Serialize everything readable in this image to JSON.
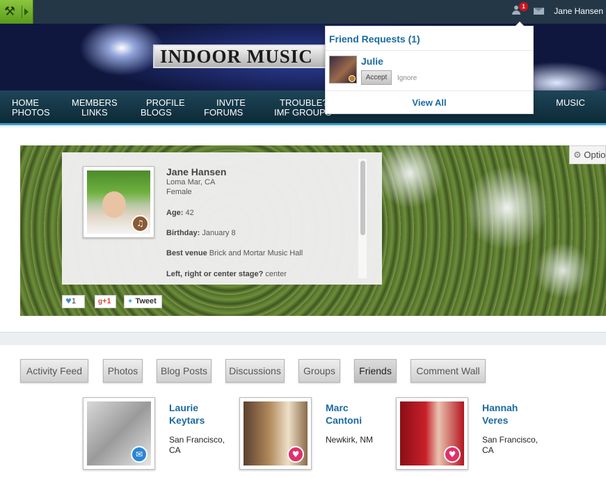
{
  "topbar": {
    "notification_count": "1",
    "username": "Jane Hansen",
    "icons": [
      "apps-tool-icon",
      "friend-requests-icon",
      "mail-icon"
    ]
  },
  "banner": {
    "logo_text": "INDOOR MUSIC"
  },
  "nav": {
    "items": [
      {
        "line1": "HOME",
        "line2": "PHOTOS"
      },
      {
        "line1": "MEMBERS",
        "line2": "LINKS"
      },
      {
        "line1": "PROFILE",
        "line2": "BLOGS"
      },
      {
        "line1": "INVITE",
        "line2": "FORUMS"
      },
      {
        "line1": "TROUBLE?",
        "line2": "IMF GROUPS"
      },
      {
        "line1": "MUSIC",
        "line2": ""
      }
    ]
  },
  "friend_requests": {
    "title": "Friend Requests (1)",
    "requests": [
      {
        "name": "Julie",
        "accept_label": "Accept",
        "ignore_label": "Ignore"
      }
    ],
    "view_all_label": "View All"
  },
  "profile": {
    "name": "Jane Hansen",
    "location": "Loma Mar, CA",
    "gender": "Female",
    "fields": [
      {
        "label": "Age:",
        "value": "42"
      },
      {
        "label": "Birthday:",
        "value": "January 8"
      },
      {
        "label": "Best venue",
        "value": "Brick and Mortar Music Hall"
      },
      {
        "label": "Left, right or center stage?",
        "value": "center"
      }
    ],
    "options_label": "Options",
    "share": {
      "like_count": "1",
      "gplus_label": "+1",
      "tweet_label": "Tweet"
    }
  },
  "tabs": [
    "Activity Feed",
    "Photos",
    "Blog Posts",
    "Discussions",
    "Groups",
    "Friends",
    "Comment Wall"
  ],
  "active_tab": "Friends",
  "friends": [
    {
      "first": "Laurie",
      "last": "Keytars",
      "city": "San Francisco,",
      "state": "CA",
      "badge": "megaphone-icon"
    },
    {
      "first": "Marc",
      "last": "Cantoni",
      "city": "Newkirk, NM",
      "state": "",
      "badge": "heart-icon"
    },
    {
      "first": "Hannah",
      "last": "Veres",
      "city": "San Francisco,",
      "state": "CA",
      "badge": "heart-icon"
    }
  ],
  "colors": {
    "topbar": "#243746",
    "link_blue": "#1a6aa0",
    "nav_accent": "#35a0c6",
    "badge_red": "#d0131b",
    "heart_pink": "#e0306a",
    "megaphone_blue": "#2a86d6"
  }
}
